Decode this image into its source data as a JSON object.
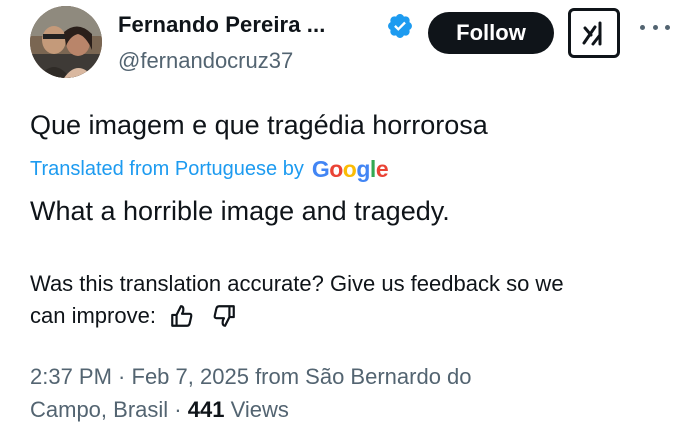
{
  "author": {
    "display_name": "Fernando Pereira ...",
    "handle": "@fernandocruz37",
    "verified": true
  },
  "header": {
    "follow_label": "Follow"
  },
  "tweet": {
    "original_text": "Que imagem e que tragédia horrorosa",
    "translated_from": "Translated from Portuguese by",
    "translation_provider": "Google",
    "translated_text": "What a horrible image and tragedy."
  },
  "feedback": {
    "question": "Was this translation accurate? Give us feedback so we",
    "question_continued": "can improve:"
  },
  "meta": {
    "time": "2:37 PM",
    "date": "Feb 7, 2025",
    "location_line1": "from São Bernardo do",
    "location_line2": "Campo, Brasil",
    "views_count": "441",
    "views_label": "Views"
  },
  "colors": {
    "text": "#0f1419",
    "secondary": "#536471",
    "link": "#1d9bf0",
    "verified": "#1d9bf0",
    "follow_bg": "#0f1419"
  }
}
